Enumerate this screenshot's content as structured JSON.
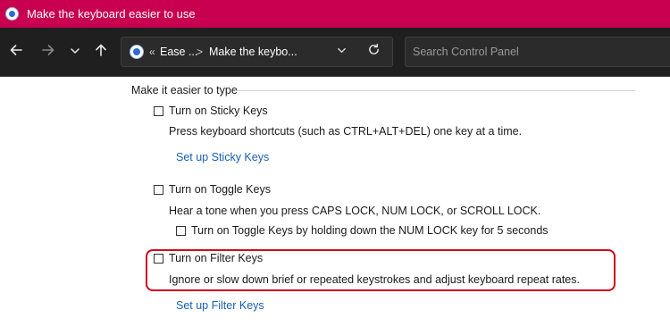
{
  "window": {
    "title": "Make the keyboard easier to use",
    "app_icon": "control-panel-icon"
  },
  "navigation": {
    "back_icon": "arrow-left-icon",
    "forward_icon": "arrow-right-icon",
    "recent_icon": "chevron-down-icon",
    "up_icon": "arrow-up-icon",
    "address": {
      "prefix": "«",
      "crumbs": [
        "Ease ...",
        "Make the keybo..."
      ],
      "separator": ">"
    },
    "search_placeholder": "Search Control Panel"
  },
  "content": {
    "section_heading": "Make it easier to type",
    "sticky_keys": {
      "label": "Turn on Sticky Keys",
      "checked": false,
      "description": "Press keyboard shortcuts (such as CTRL+ALT+DEL) one key at a time.",
      "link": "Set up Sticky Keys"
    },
    "toggle_keys": {
      "label": "Turn on Toggle Keys",
      "checked": false,
      "description": "Hear a tone when you press CAPS LOCK, NUM LOCK, or SCROLL LOCK.",
      "sub_option": {
        "label": "Turn on Toggle Keys by holding down the NUM LOCK key for 5 seconds",
        "checked": false
      }
    },
    "filter_keys": {
      "label": "Turn on Filter Keys",
      "checked": false,
      "description": "Ignore or slow down brief or repeated keystrokes and adjust keyboard repeat rates.",
      "link": "Set up Filter Keys",
      "highlighted": true
    }
  },
  "colors": {
    "titlebar": "#c8004f",
    "highlight": "#d0021b",
    "link": "#1a5fb4"
  }
}
